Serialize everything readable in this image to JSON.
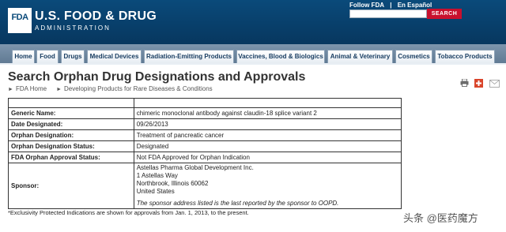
{
  "header": {
    "logo_mark": "FDA",
    "title": "U.S. FOOD & DRUG",
    "subtitle": "ADMINISTRATION",
    "follow_link": "Follow FDA",
    "spanish_link": "En Español",
    "search_placeholder": "",
    "search_button": "SEARCH",
    "brand_color": "#0a4a7a",
    "search_color": "#c8102e"
  },
  "nav": {
    "items": [
      "Home",
      "Food",
      "Drugs",
      "Medical Devices",
      "Radiation-Emitting Products",
      "Vaccines, Blood & Biologics",
      "Animal & Veterinary",
      "Cosmetics",
      "Tobacco Products"
    ]
  },
  "page": {
    "title": "Search Orphan Drug Designations and Approvals",
    "breadcrumb": [
      "FDA Home",
      "Developing Products for Rare Diseases & Conditions"
    ],
    "tool_icons": [
      "print-icon",
      "plus-icon",
      "mail-icon"
    ]
  },
  "details": {
    "generic_name_label": "Generic Name:",
    "generic_name": "chimeric monoclonal antibody against claudin-18 splice variant 2",
    "date_designated_label": "Date Designated:",
    "date_designated": "09/26/2013",
    "orphan_designation_label": "Orphan Designation:",
    "orphan_designation": "Treatment of pancreatic cancer",
    "orphan_status_label": "Orphan Designation Status:",
    "orphan_status": "Designated",
    "approval_status_label": "FDA Orphan Approval Status:",
    "approval_status": "Not FDA Approved for Orphan Indication",
    "sponsor_label": "Sponsor:",
    "sponsor_lines": [
      "Astellas Pharma Global Development Inc.",
      "1 Astellas Way",
      "Northbrook, Illinois 60062",
      "United States"
    ],
    "sponsor_note": "The sponsor address listed is the last reported by the sponsor to OOPD."
  },
  "footnote": "*Exclusivity Protected Indications are shown for approvals from Jan. 1, 2013, to the present.",
  "watermark": "头条 @医药魔方"
}
